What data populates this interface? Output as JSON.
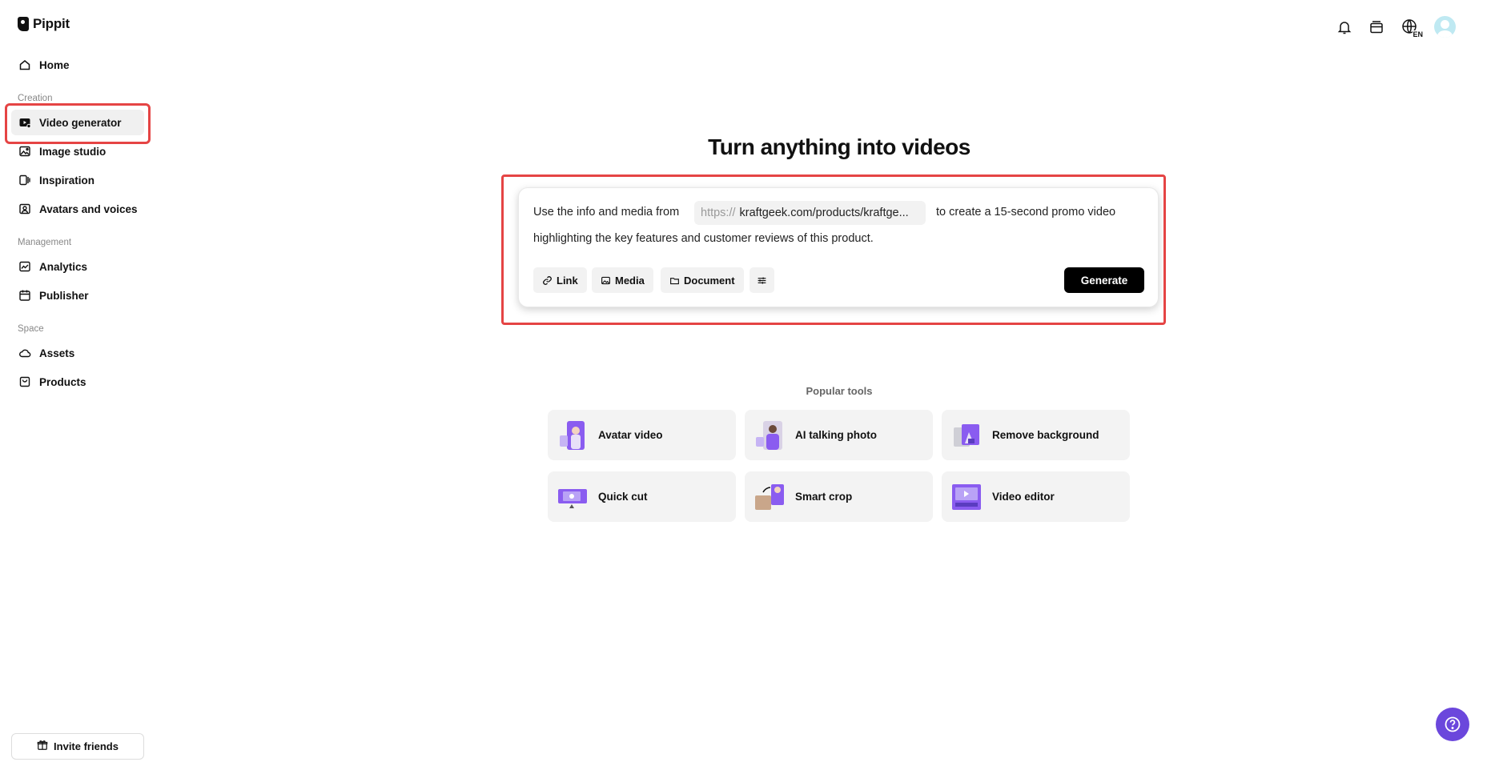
{
  "app": {
    "logo_text": "Pippit"
  },
  "sidebar": {
    "home": "Home",
    "sections": {
      "creation": "Creation",
      "management": "Management",
      "space": "Space"
    },
    "items": {
      "video_generator": "Video generator",
      "image_studio": "Image studio",
      "inspiration": "Inspiration",
      "avatars_voices": "Avatars and voices",
      "analytics": "Analytics",
      "publisher": "Publisher",
      "assets": "Assets",
      "products": "Products"
    },
    "active": "Video generator",
    "invite": "Invite friends"
  },
  "header": {
    "language": "EN"
  },
  "main": {
    "title": "Turn anything into videos",
    "prompt": {
      "before_url": "Use the info and media from",
      "url_prefix": "https://",
      "url_value": "kraftgeek.com/products/kraftge...",
      "after_url": "to create a 15-second promo video",
      "line2": "highlighting the key features and customer reviews of this product."
    },
    "toolbar": {
      "link": "Link",
      "media": "Media",
      "document": "Document",
      "generate": "Generate"
    },
    "popular_label": "Popular tools",
    "tools": [
      {
        "label": "Avatar video"
      },
      {
        "label": "AI talking photo"
      },
      {
        "label": "Remove background"
      },
      {
        "label": "Quick cut"
      },
      {
        "label": "Smart crop"
      },
      {
        "label": "Video editor"
      }
    ]
  },
  "colors": {
    "accent": "#6b47dc",
    "highlight": "#e54444",
    "generate_bg": "#000000"
  }
}
